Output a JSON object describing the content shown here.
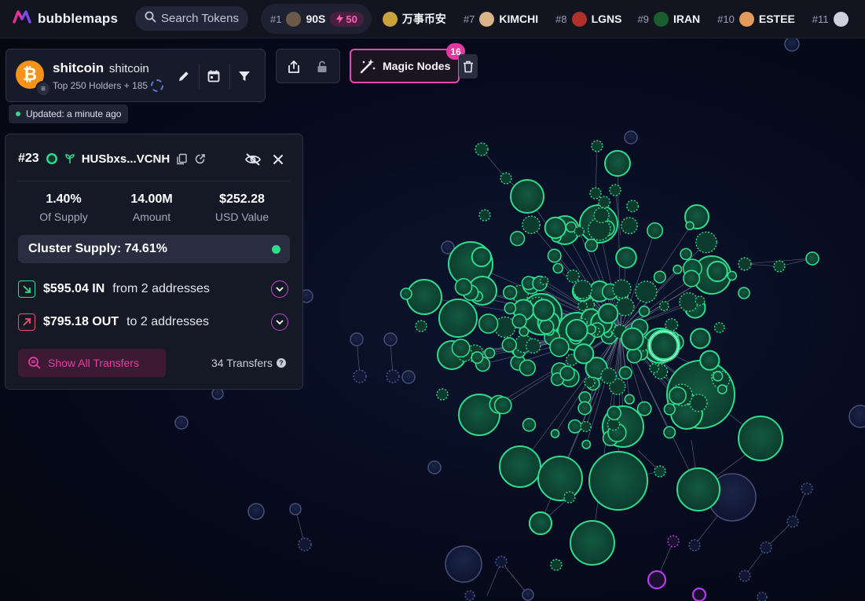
{
  "app": {
    "brand": "bubblemaps",
    "logo_icon": "bubblemaps-logo-icon"
  },
  "search": {
    "label": "Search Tokens",
    "icon": "search-icon"
  },
  "trending": [
    {
      "rank": "#1",
      "name": "90S",
      "boost": "50",
      "color": "#6b5a48"
    },
    {
      "rank": "",
      "name": "万事币安",
      "color": "#c9a23c"
    },
    {
      "rank": "#7",
      "name": "KIMCHI",
      "color": "#d9b48a"
    },
    {
      "rank": "#8",
      "name": "LGNS",
      "color": "#b0302a"
    },
    {
      "rank": "#9",
      "name": "IRAN",
      "color": "#1b5e2e"
    },
    {
      "rank": "#10",
      "name": "ESTEE",
      "color": "#e39a5a"
    },
    {
      "rank": "#11",
      "name": "",
      "color": "#cfd2de"
    }
  ],
  "token": {
    "name": "shitcoin",
    "symbol": "shitcoin",
    "subtitle": "Top 250 Holders + 185",
    "icon": "bitcoin-icon",
    "actions": [
      "edit-icon",
      "calendar-icon",
      "filter-icon"
    ]
  },
  "toolbar": {
    "share_icon": "share-icon",
    "lock_icon": "lock-icon",
    "magic_label": "Magic Nodes",
    "magic_count": "16",
    "trash_icon": "trash-icon"
  },
  "status": {
    "updated": "Updated: a minute ago"
  },
  "wallet": {
    "rank": "#23",
    "address": "HUSbxs...VCNH",
    "stats": [
      {
        "value": "1.40%",
        "label": "Of Supply"
      },
      {
        "value": "14.00M",
        "label": "Amount"
      },
      {
        "value": "$252.28",
        "label": "USD Value"
      }
    ],
    "cluster_supply": "Cluster Supply: 74.61%",
    "inflow": {
      "value": "$595.04 IN",
      "desc": "from 2 addresses"
    },
    "outflow": {
      "value": "$795.18 OUT",
      "desc": "to 2 addresses"
    },
    "show_transfers": "Show All Transfers",
    "transfers_count": "34 Transfers"
  },
  "colors": {
    "accent_pink": "#e14bb0",
    "node_green": "#2fdc8e",
    "node_fill": "#0f4a37",
    "bg": "#070a1c"
  }
}
